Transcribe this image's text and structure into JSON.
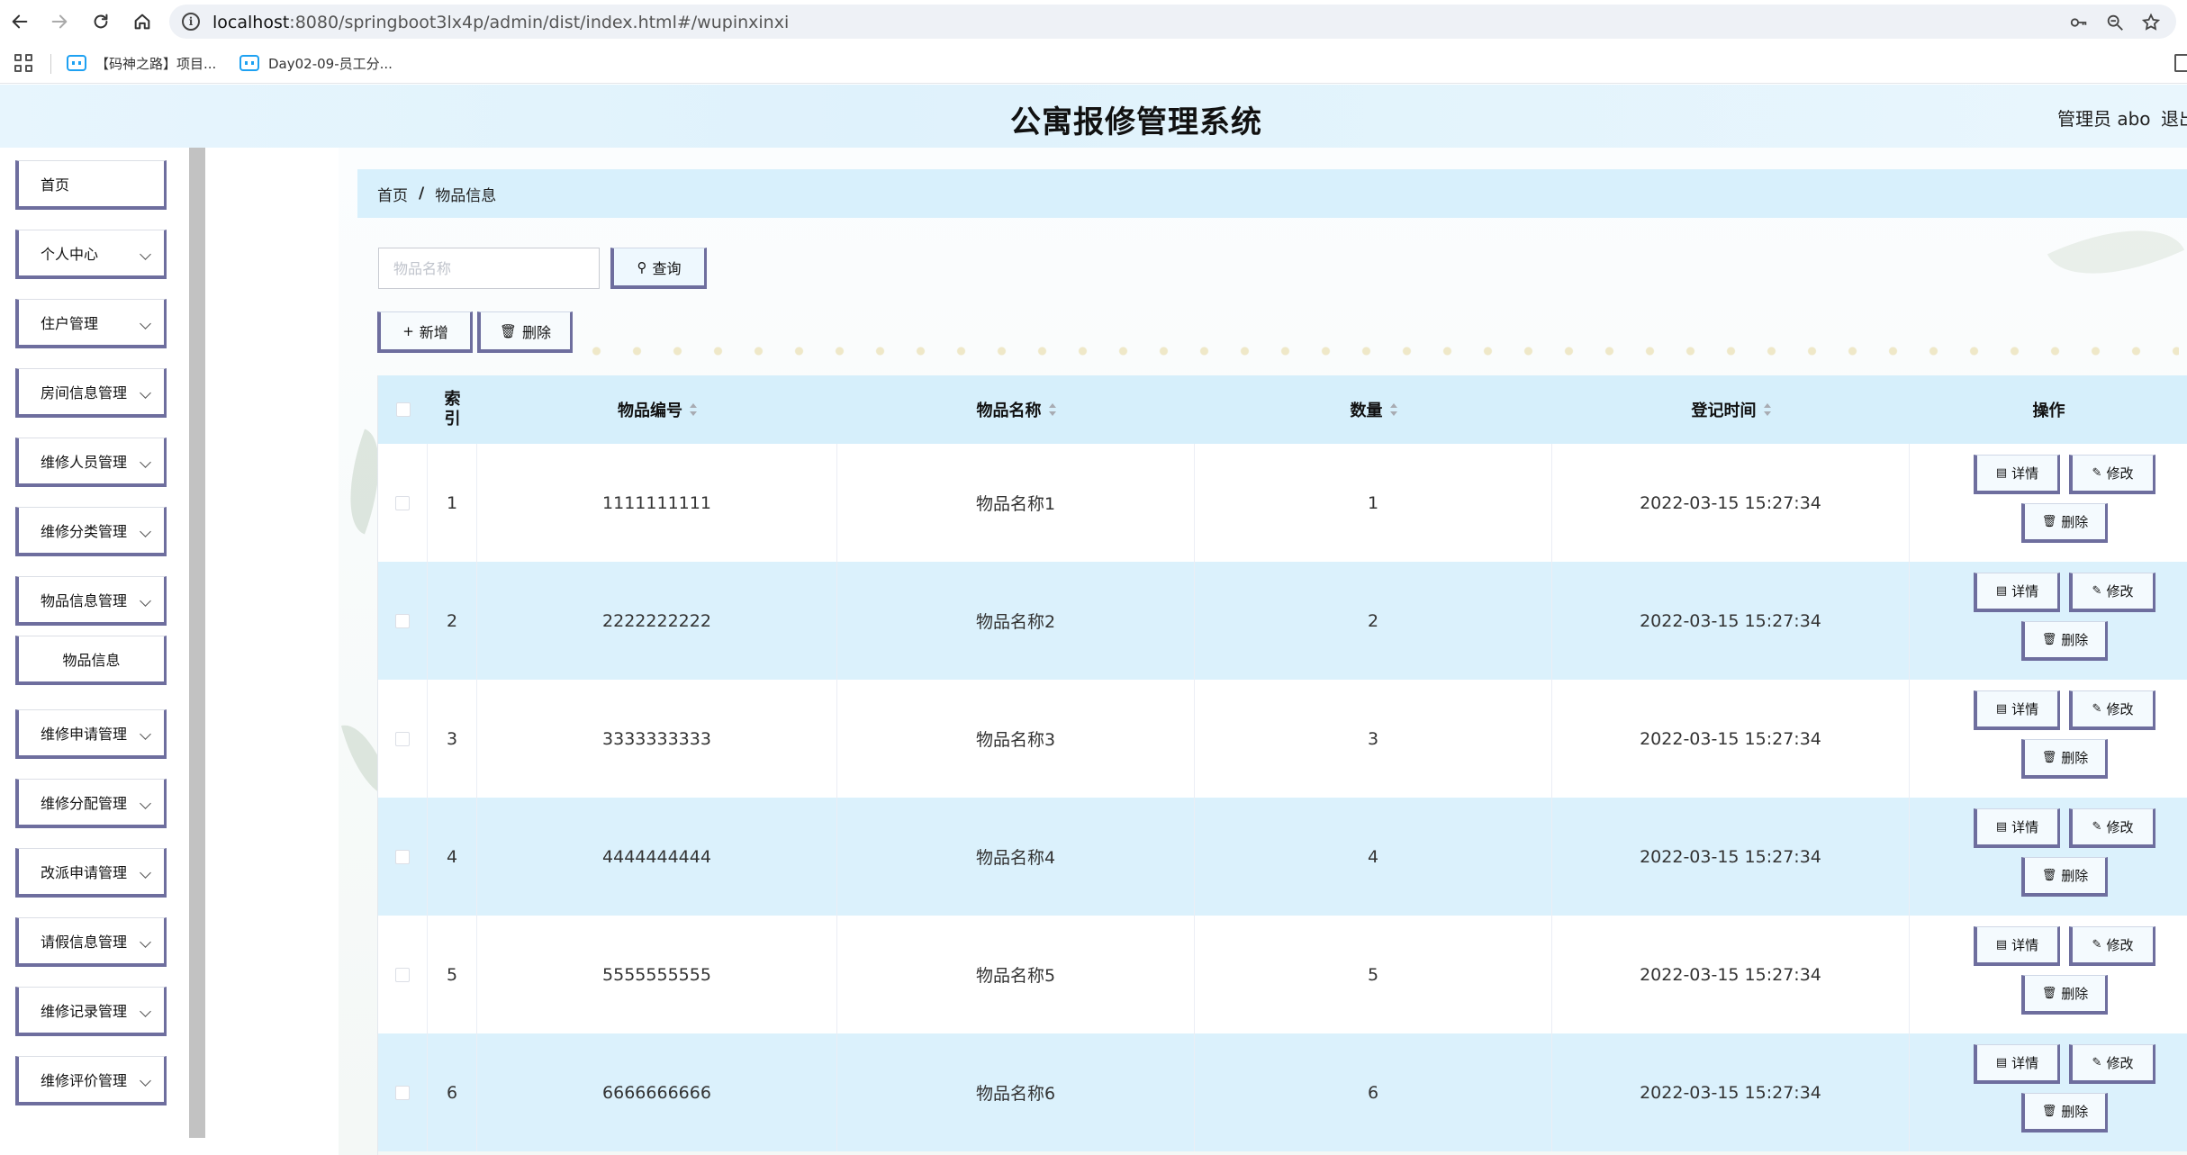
{
  "browser": {
    "url_host": "localhost",
    "url_rest": ":8080/springboot3lx4p/admin/dist/index.html#/wupinxinxi",
    "bookmarks": [
      {
        "label": "【码神之路】项目..."
      },
      {
        "label": "Day02-09-员工分..."
      }
    ]
  },
  "header": {
    "title": "公寓报修管理系统",
    "user": "管理员 abo",
    "logout": "退出"
  },
  "sidebar": {
    "items": [
      {
        "label": "首页",
        "has_children": false
      },
      {
        "label": "个人中心",
        "has_children": true
      },
      {
        "label": "住户管理",
        "has_children": true
      },
      {
        "label": "房间信息管理",
        "has_children": true
      },
      {
        "label": "维修人员管理",
        "has_children": true
      },
      {
        "label": "维修分类管理",
        "has_children": true
      },
      {
        "label": "物品信息管理",
        "has_children": true
      },
      {
        "label": "物品信息",
        "has_children": false,
        "submenu": true
      },
      {
        "label": "维修申请管理",
        "has_children": true
      },
      {
        "label": "维修分配管理",
        "has_children": true
      },
      {
        "label": "改派申请管理",
        "has_children": true
      },
      {
        "label": "请假信息管理",
        "has_children": true
      },
      {
        "label": "维修记录管理",
        "has_children": true
      },
      {
        "label": "维修评价管理",
        "has_children": true
      }
    ]
  },
  "breadcrumb": {
    "home": "首页",
    "separator": "/",
    "current": "物品信息"
  },
  "search": {
    "placeholder": "物品名称",
    "value": "",
    "button": "查询"
  },
  "actions": {
    "add": "新增",
    "delete": "删除"
  },
  "table": {
    "columns": {
      "index": "索引",
      "code": "物品编号",
      "name": "物品名称",
      "quantity": "数量",
      "time": "登记时间",
      "ops": "操作"
    },
    "rows": [
      {
        "index": "1",
        "code": "1111111111",
        "name": "物品名称1",
        "quantity": "1",
        "time": "2022-03-15 15:27:34"
      },
      {
        "index": "2",
        "code": "2222222222",
        "name": "物品名称2",
        "quantity": "2",
        "time": "2022-03-15 15:27:34"
      },
      {
        "index": "3",
        "code": "3333333333",
        "name": "物品名称3",
        "quantity": "3",
        "time": "2022-03-15 15:27:34"
      },
      {
        "index": "4",
        "code": "4444444444",
        "name": "物品名称4",
        "quantity": "4",
        "time": "2022-03-15 15:27:34"
      },
      {
        "index": "5",
        "code": "5555555555",
        "name": "物品名称5",
        "quantity": "5",
        "time": "2022-03-15 15:27:34"
      },
      {
        "index": "6",
        "code": "6666666666",
        "name": "物品名称6",
        "quantity": "6",
        "time": "2022-03-15 15:27:34"
      }
    ],
    "row_actions": {
      "detail": "详情",
      "edit": "修改",
      "delete": "删除"
    }
  },
  "colors": {
    "header_bg": "#e4f4fc",
    "row_alt": "#dbf1fc",
    "button_border": "#6e6e9e"
  }
}
